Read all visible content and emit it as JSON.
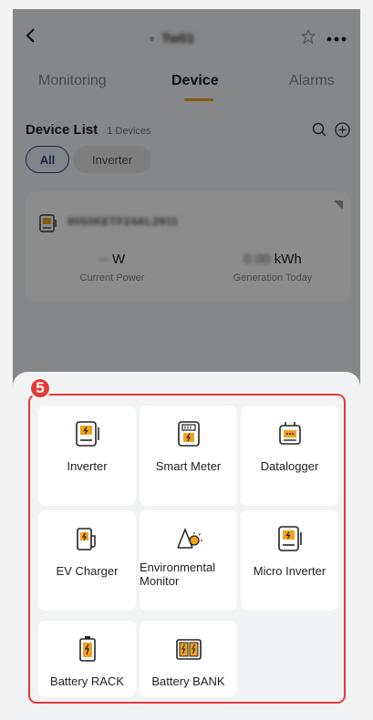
{
  "header": {
    "back_icon": "chevron-left-icon",
    "title": "Tw01",
    "star_icon": "star-outline-icon",
    "more_icon": "more-horizontal-icon"
  },
  "tabs": [
    {
      "label": "Monitoring",
      "active": false
    },
    {
      "label": "Device",
      "active": true
    },
    {
      "label": "Alarms",
      "active": false
    }
  ],
  "device_list": {
    "title": "Device List",
    "count": "1 Devices",
    "filters": [
      {
        "label": "All",
        "selected": true
      },
      {
        "label": "Inverter",
        "selected": false
      }
    ]
  },
  "device": {
    "serial": "9050KETF24AL2911",
    "power_value": "--",
    "power_unit": "W",
    "power_label": "Current Power",
    "generation_value": "0.00",
    "generation_unit": "kWh",
    "generation_label": "Generation Today"
  },
  "sheet": {
    "step_number": "5",
    "items": [
      {
        "label": "Inverter",
        "icon": "inverter-icon"
      },
      {
        "label": "Smart Meter",
        "icon": "smart-meter-icon"
      },
      {
        "label": "Datalogger",
        "icon": "datalogger-icon"
      },
      {
        "label": "EV Charger",
        "icon": "ev-charger-icon"
      },
      {
        "label": "Environmental Monitor",
        "icon": "environmental-monitor-icon"
      },
      {
        "label": "Micro Inverter",
        "icon": "micro-inverter-icon"
      },
      {
        "label": "Battery RACK",
        "icon": "battery-rack-icon"
      },
      {
        "label": "Battery BANK",
        "icon": "battery-bank-icon"
      }
    ]
  },
  "colors": {
    "accent_tab": "#f3a21b",
    "annotation_red": "#e33b36",
    "chip_blue": "#2d4a7a"
  }
}
